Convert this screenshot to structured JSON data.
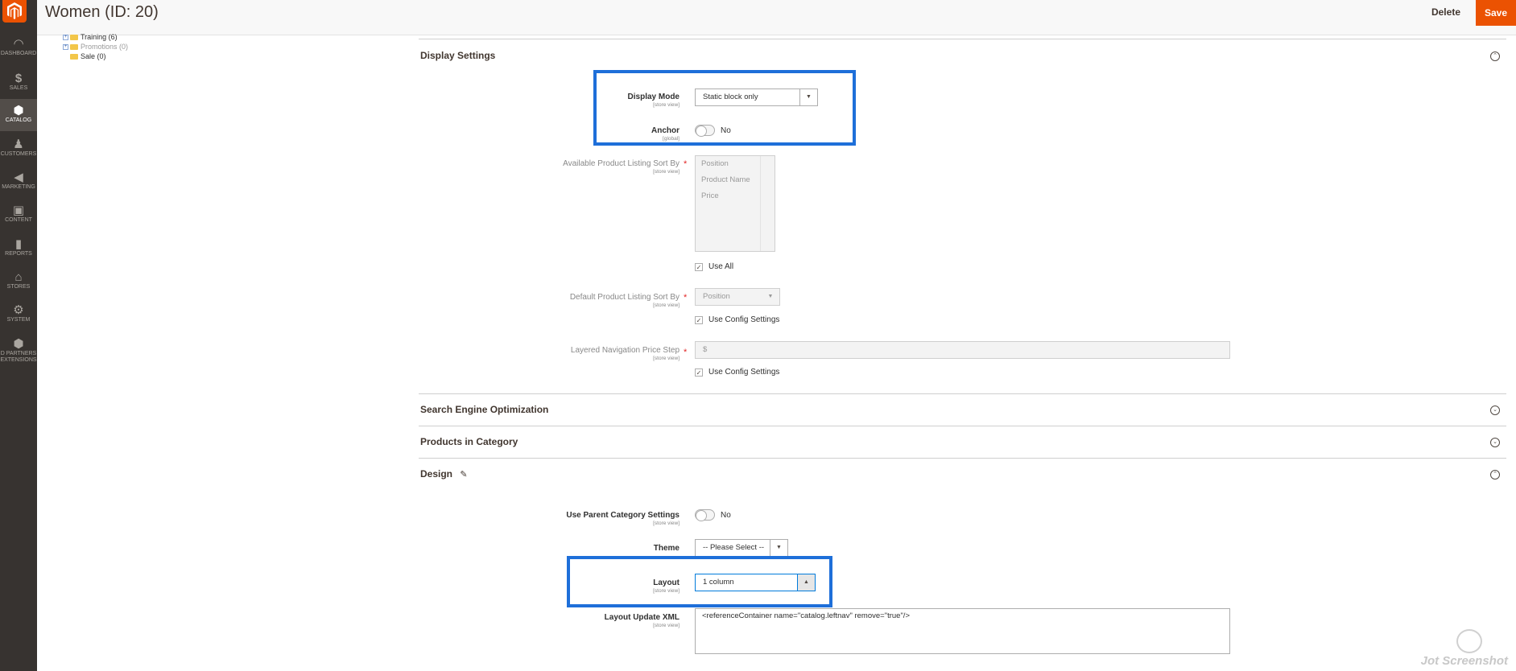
{
  "header": {
    "title": "Women (ID: 20)",
    "delete_label": "Delete",
    "save_label": "Save"
  },
  "sidebar": {
    "items": [
      {
        "label": "DASHBOARD",
        "icon": "dashboard-icon"
      },
      {
        "label": "SALES",
        "icon": "dollar-icon"
      },
      {
        "label": "CATALOG",
        "icon": "cube-icon",
        "active": true
      },
      {
        "label": "CUSTOMERS",
        "icon": "person-icon"
      },
      {
        "label": "MARKETING",
        "icon": "megaphone-icon"
      },
      {
        "label": "CONTENT",
        "icon": "layout-icon"
      },
      {
        "label": "REPORTS",
        "icon": "bar-chart-icon"
      },
      {
        "label": "STORES",
        "icon": "store-icon"
      },
      {
        "label": "SYSTEM",
        "icon": "gear-icon"
      },
      {
        "label": "D PARTNERS",
        "label2": "EXTENSIONS",
        "icon": "box-icon"
      }
    ]
  },
  "tree": {
    "items": [
      {
        "label": "Training (6)",
        "expandable": true,
        "muted": false
      },
      {
        "label": "Promotions (0)",
        "expandable": true,
        "muted": true
      },
      {
        "label": "Sale (0)",
        "expandable": false,
        "muted": false
      }
    ]
  },
  "display_settings": {
    "title": "Display Settings",
    "display_mode": {
      "label": "Display Mode",
      "scope": "[store view]",
      "value": "Static block only"
    },
    "anchor": {
      "label": "Anchor",
      "scope": "[global]",
      "value": "No"
    },
    "available_sort": {
      "label": "Available Product Listing Sort By",
      "scope": "[store view]",
      "options": [
        "Position",
        "Product Name",
        "Price"
      ],
      "use_all_label": "Use All"
    },
    "default_sort": {
      "label": "Default Product Listing Sort By",
      "scope": "[store view]",
      "value": "Position",
      "use_config_label": "Use Config Settings"
    },
    "price_step": {
      "label": "Layered Navigation Price Step",
      "scope": "[store view]",
      "prefix": "$",
      "use_config_label": "Use Config Settings"
    }
  },
  "sections": {
    "seo": "Search Engine Optimization",
    "products": "Products in Category",
    "design": "Design"
  },
  "design": {
    "use_parent": {
      "label": "Use Parent Category Settings",
      "scope": "[store view]",
      "value": "No"
    },
    "theme": {
      "label": "Theme",
      "value": "-- Please Select --"
    },
    "layout": {
      "label": "Layout",
      "scope": "[store view]",
      "value": "1 column"
    },
    "layout_xml": {
      "label": "Layout Update XML",
      "scope": "[store view]",
      "value": "<referenceContainer name=\"catalog.leftnav\" remove=\"true\"/>"
    }
  },
  "watermark": "Jot Screenshot",
  "colors": {
    "accent": "#eb5202",
    "highlight": "#1e6fd9",
    "sidebar": "#373330"
  }
}
